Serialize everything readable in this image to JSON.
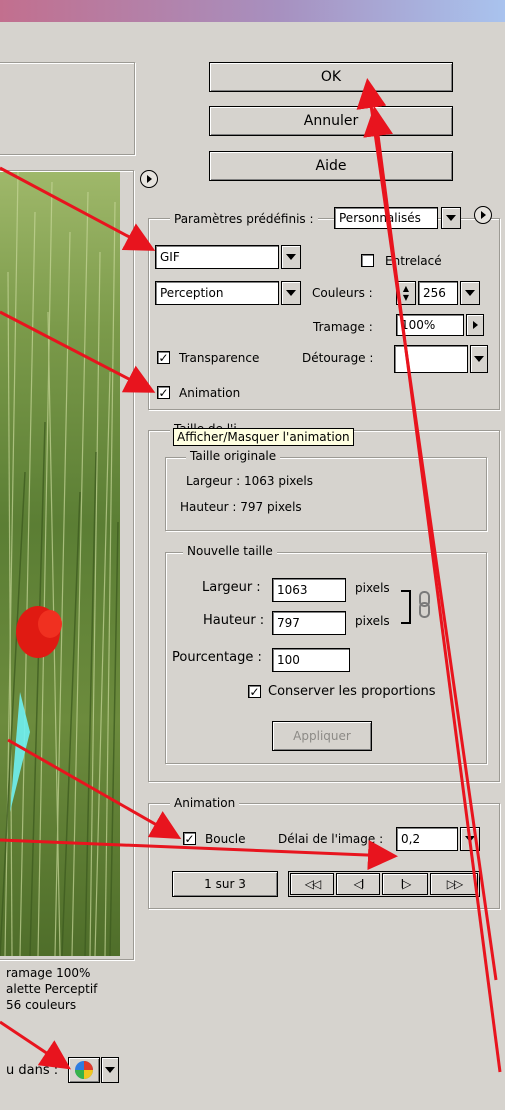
{
  "buttons": {
    "ok": "OK",
    "cancel": "Annuler",
    "help": "Aide"
  },
  "preset": {
    "label": "Paramètres prédéfinis :",
    "value": "Personnalisés"
  },
  "format": {
    "value": "GIF"
  },
  "interlaced": {
    "label": "Entrelacé",
    "checked": false
  },
  "palette": {
    "value": "Perception"
  },
  "colors": {
    "label": "Couleurs :",
    "value": "256"
  },
  "dither": {
    "label": "Tramage :",
    "value": "100%"
  },
  "transparency": {
    "label": "Transparence",
    "checked": true
  },
  "matte": {
    "label": "Détourage :",
    "value": ""
  },
  "animation_check": {
    "label": "Animation",
    "checked": true
  },
  "tooltip": {
    "text": "Afficher/Masquer l'animation"
  },
  "image_size": {
    "legend_partial": "Taille de l'i",
    "original": {
      "legend": "Taille originale",
      "width": "Largeur : 1063 pixels",
      "height": "Hauteur : 797 pixels"
    },
    "new": {
      "legend": "Nouvelle taille",
      "width_label": "Largeur :",
      "width_value": "1063",
      "width_unit": "pixels",
      "height_label": "Hauteur :",
      "height_value": "797",
      "height_unit": "pixels",
      "percent_label": "Pourcentage :",
      "percent_value": "100",
      "constrain_label": "Conserver les proportions",
      "apply": "Appliquer"
    }
  },
  "animation": {
    "legend": "Animation",
    "loop_label": "Boucle",
    "delay_label": "Délai de l'image :",
    "delay_value": "0,2",
    "frame_counter": "1 sur 3",
    "nav": {
      "first": "◁◁",
      "prev": "◁I",
      "next": "I▷",
      "last": "▷▷"
    }
  },
  "preview_info": {
    "line1": "ramage 100%",
    "line2": "alette Perceptif",
    "line3": "56 couleurs"
  },
  "bottom": {
    "label": "u dans :"
  },
  "colors_theme": {
    "tooltip_bg": "#ffffe1",
    "annotation_red": "#e8141e",
    "annotation_cyan": "#6ff0f2"
  }
}
